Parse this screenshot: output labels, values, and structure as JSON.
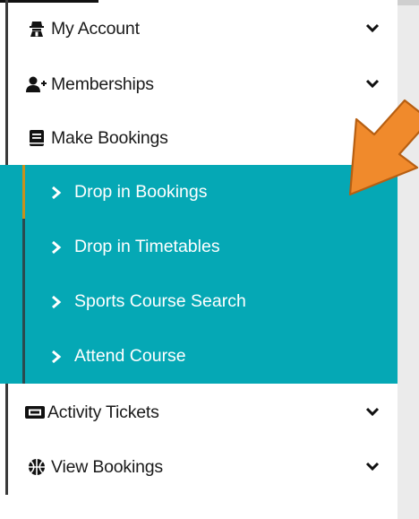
{
  "menu": {
    "items": [
      {
        "label": "My Account",
        "icon": "user-secret-icon"
      },
      {
        "label": "Memberships",
        "icon": "user-plus-icon"
      },
      {
        "label": "Make Bookings",
        "icon": "book-icon"
      },
      {
        "label": "Activity Tickets",
        "icon": "ticket-icon"
      },
      {
        "label": "View Bookings",
        "icon": "basketball-icon"
      }
    ],
    "submenu": [
      {
        "label": "Drop in Bookings",
        "active": true
      },
      {
        "label": "Drop in Timetables"
      },
      {
        "label": "Sports Course Search"
      },
      {
        "label": "Attend Course"
      }
    ]
  },
  "colors": {
    "submenu_bg": "#05a8b5",
    "active_marker": "#c7911c",
    "arrow": "#f08a2c"
  }
}
